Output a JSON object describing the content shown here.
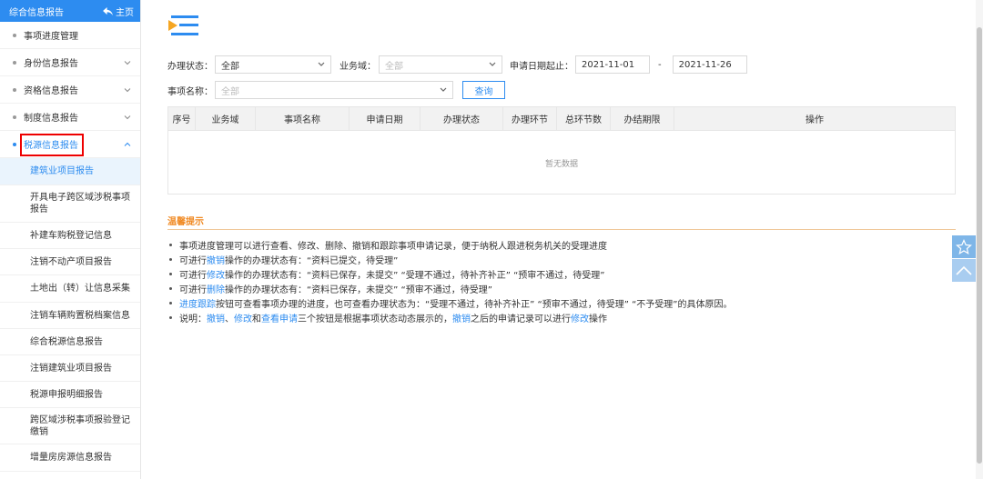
{
  "sidebar": {
    "title": "综合信息报告",
    "home_label": "主页",
    "items": [
      {
        "label": "事项进度管理",
        "expandable": false
      },
      {
        "label": "身份信息报告",
        "expandable": true
      },
      {
        "label": "资格信息报告",
        "expandable": true
      },
      {
        "label": "制度信息报告",
        "expandable": true
      },
      {
        "label": "税源信息报告",
        "expandable": true,
        "expanded": true
      }
    ],
    "sub_items": [
      "建筑业项目报告",
      "开具电子跨区域涉税事项报告",
      "补建车购税登记信息",
      "注销不动产项目报告",
      "土地出（转）让信息采集",
      "注销车辆购置税档案信息",
      "综合税源信息报告",
      "注销建筑业项目报告",
      "税源申报明细报告",
      "跨区域涉税事项报验登记缴销",
      "增量房房源信息报告"
    ]
  },
  "form": {
    "status_label": "办理状态：",
    "status_value": "全部",
    "domain_label": "业务域：",
    "domain_placeholder": "全部",
    "date_label": "申请日期起止：",
    "date_from": "2021-11-01",
    "date_sep": "-",
    "date_to": "2021-11-26",
    "name_label": "事项名称：",
    "name_placeholder": "全部",
    "query_button": "查询"
  },
  "table": {
    "headers": [
      "序号",
      "业务域",
      "事项名称",
      "申请日期",
      "办理状态",
      "办理环节",
      "总环节数",
      "办结期限",
      "操作"
    ],
    "empty_text": "暂无数据"
  },
  "tips": {
    "title": "温馨提示",
    "lines": [
      [
        {
          "t": "事项进度管理可以进行查看、修改、删除、撤销和跟踪事项申请记录，便于纳税人跟进税务机关的受理进度"
        }
      ],
      [
        {
          "t": "可进行"
        },
        {
          "t": "撤销",
          "blue": true
        },
        {
          "t": "操作的办理状态有：“资料已提交，待受理”"
        }
      ],
      [
        {
          "t": "可进行"
        },
        {
          "t": "修改",
          "blue": true
        },
        {
          "t": "操作的办理状态有：“资料已保存，未提交”  “受理不通过，待补齐补正”  “预审不通过，待受理”"
        }
      ],
      [
        {
          "t": "可进行"
        },
        {
          "t": "删除",
          "blue": true
        },
        {
          "t": "操作的办理状态有：“资料已保存，未提交”  “预审不通过，待受理”"
        }
      ],
      [
        {
          "t": "进度跟踪",
          "blue": true
        },
        {
          "t": "按钮可查看事项办理的进度，也可查看办理状态为：“受理不通过，待补齐补正”  “预审不通过，待受理”  “不予受理”的具体原因。"
        }
      ],
      [
        {
          "t": "说明："
        },
        {
          "t": "撤销",
          "blue": true
        },
        {
          "t": "、"
        },
        {
          "t": "修改",
          "blue": true
        },
        {
          "t": "和"
        },
        {
          "t": "查看申请",
          "blue": true
        },
        {
          "t": "三个按钮是根据事项状态动态展示的，"
        },
        {
          "t": "撤销",
          "blue": true
        },
        {
          "t": "之后的申请记录可以进行"
        },
        {
          "t": "修改",
          "blue": true
        },
        {
          "t": "操作"
        }
      ]
    ]
  },
  "colors": {
    "accent": "#2d8cf0",
    "tips_title": "#f08a24",
    "highlight_box": "#e00000"
  },
  "icons": {
    "home": "home-arrow-icon",
    "star": "star-icon",
    "up": "chevron-up-icon",
    "menu": "menu-logo-icon"
  }
}
